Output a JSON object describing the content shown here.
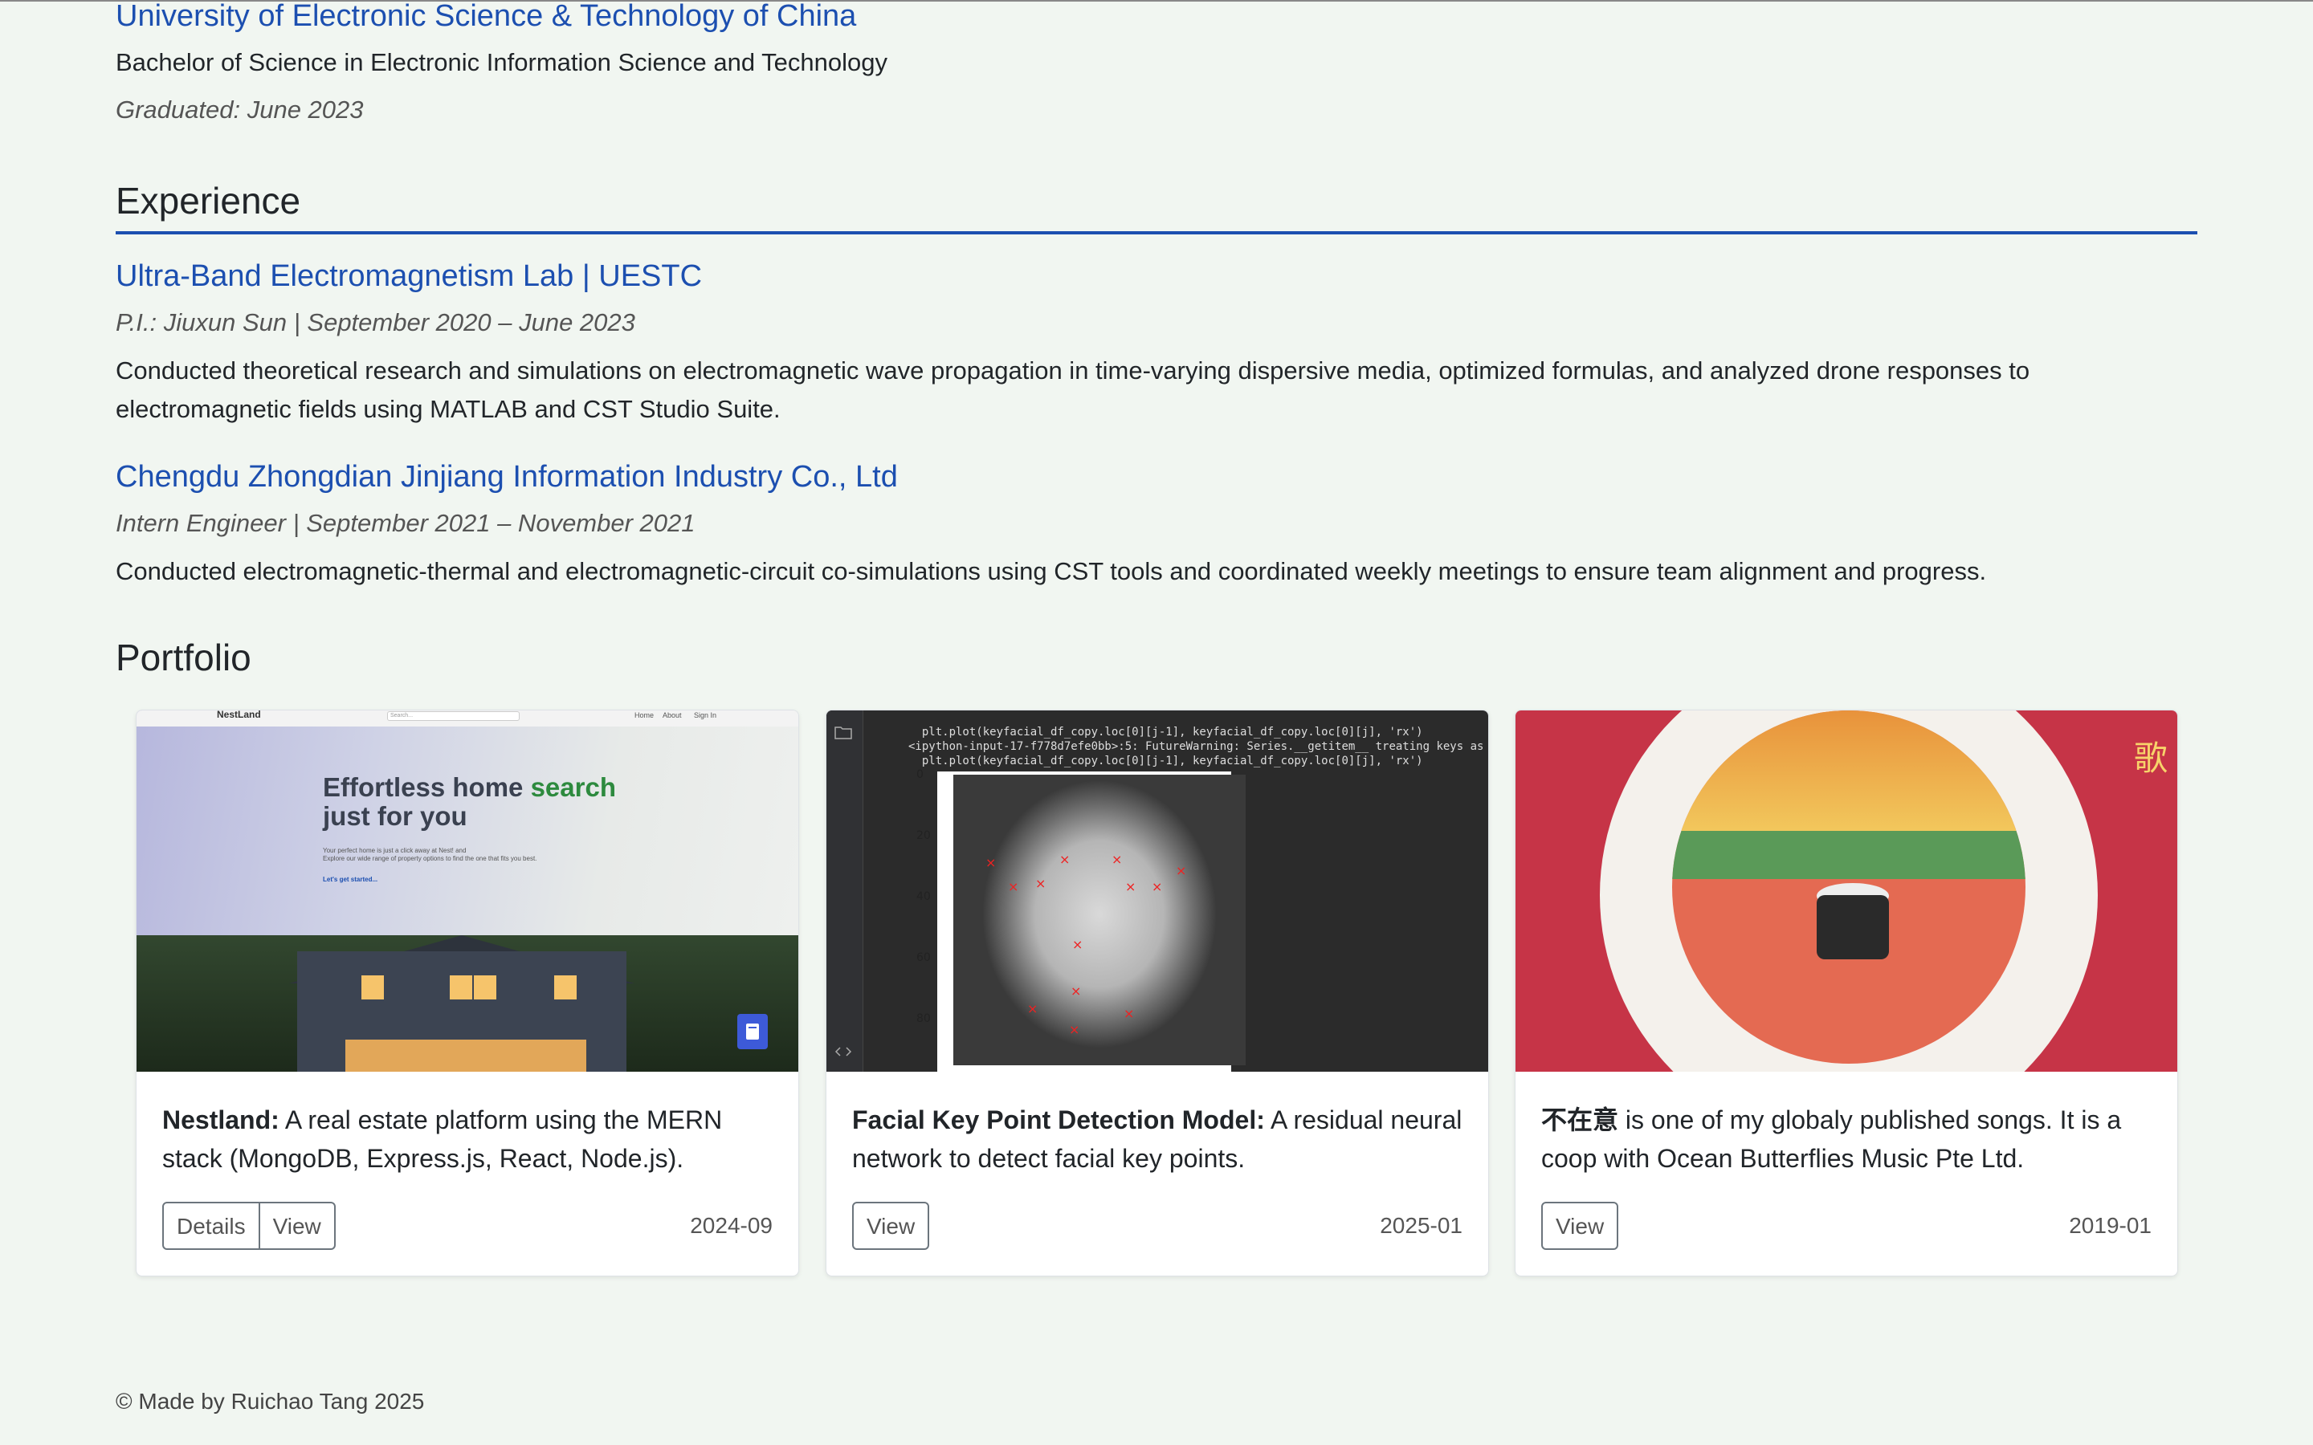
{
  "education": {
    "university": "University of Electronic Science & Technology of China",
    "degree": "Bachelor of Science in Electronic Information Science and Technology",
    "graduated": "Graduated: June 2023"
  },
  "experience": {
    "heading": "Experience",
    "jobs": [
      {
        "title": "Ultra-Band Electromagnetism Lab | UESTC",
        "meta": "P.I.: Jiuxun Sun | September 2020 – June 2023",
        "desc": "Conducted theoretical research and simulations on electromagnetic wave propagation in time-varying dispersive media, optimized formulas, and analyzed drone responses to electromagnetic fields using MATLAB and CST Studio Suite."
      },
      {
        "title": "Chengdu Zhongdian Jinjiang Information Industry Co., Ltd",
        "meta": "Intern Engineer | September 2021 – November 2021",
        "desc": "Conducted electromagnetic-thermal and electromagnetic-circuit co-simulations using CST tools and coordinated weekly meetings to ensure team alignment and progress."
      }
    ]
  },
  "portfolio": {
    "heading": "Portfolio",
    "cards": [
      {
        "name": "Nestland:",
        "desc": " A real estate platform using the MERN stack (MongoDB, Express.js, React, Node.js).",
        "buttons": [
          "Details",
          "View"
        ],
        "date": "2024-09",
        "thumb": {
          "logo": "NestLand",
          "search_placeholder": "Search...",
          "nav": [
            "Home",
            "About",
            "Sign In"
          ],
          "headline_a": "Effortless home",
          "headline_b": "search",
          "headline_c": "just for you",
          "sub": "Your perfect home is just a click away at Nest! and\nExplore our wide range of property options to find the one that fits you best.",
          "cta": "Let's get started..."
        }
      },
      {
        "name": "Facial Key Point Detection Model:",
        "desc": " A residual neural network to detect facial key points.",
        "buttons": [
          "View"
        ],
        "date": "2025-01",
        "thumb": {
          "code": "  plt.plot(keyfacial_df_copy.loc[0][j-1], keyfacial_df_copy.loc[0][j], 'rx')\n<ipython-input-17-f778d7efe0bb>:5: FutureWarning: Series.__getitem__ treating keys as po\n  plt.plot(keyfacial_df_copy.loc[0][j-1], keyfacial_df_copy.loc[0][j], 'rx')",
          "y_ticks": [
            "0",
            "20",
            "40",
            "60",
            "80"
          ]
        }
      },
      {
        "name": "不在意",
        "desc": " is one of my globaly published songs. It is a coop with Ocean Butterflies Music Pte Ltd.",
        "buttons": [
          "View"
        ],
        "date": "2019-01",
        "thumb": {
          "chars": "歌"
        }
      }
    ]
  },
  "footer": "© Made by Ruichao Tang 2025"
}
